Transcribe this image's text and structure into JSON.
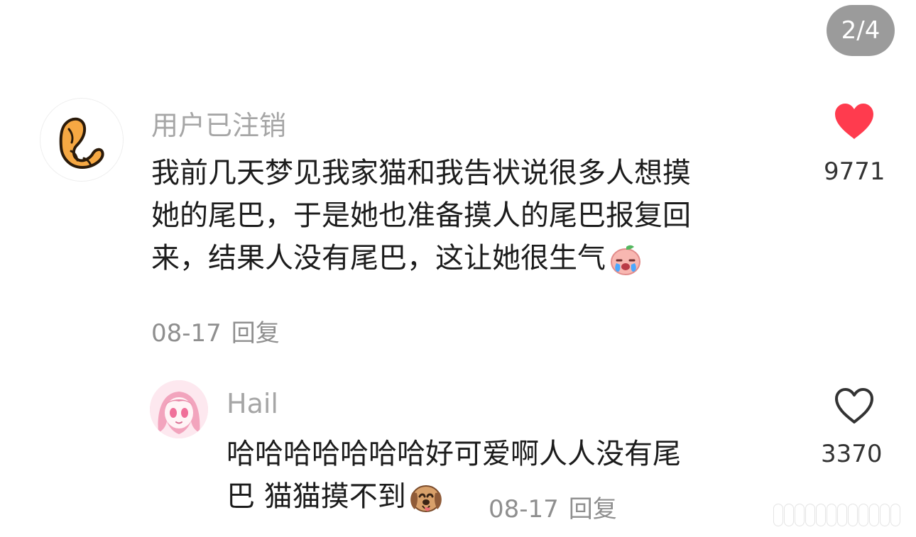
{
  "page_indicator": "2/4",
  "comment": {
    "username": "用户已注销",
    "avatar_icon": "croissant-icon",
    "lines": [
      "我前几天梦见我家猫和我告状说很多人想摸",
      "她的尾巴，于是她也准备摸人的尾巴报复回",
      "来，结果人没有尾巴，这让她很生气"
    ],
    "emoji_icon": "crying-peach-emoji",
    "date": "08-17",
    "reply_label": "回复",
    "like_count": "9771",
    "like_state": "liked",
    "like_color": "#ff3b4e"
  },
  "reply": {
    "username": "Hail",
    "avatar_icon": "anime-avatar-icon",
    "lines": [
      "哈哈哈哈哈哈哈好可爱啊人人没有尾",
      "巴 猫猫摸不到"
    ],
    "emoji_icon": "dog-emoji",
    "date": "08-17",
    "reply_label": "回复",
    "like_count": "3370",
    "like_state": "unliked"
  }
}
